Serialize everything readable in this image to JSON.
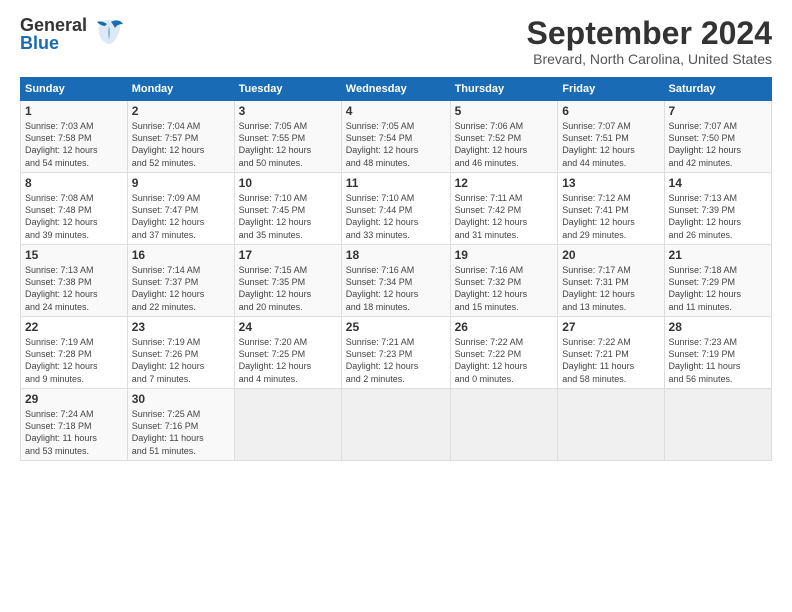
{
  "header": {
    "logo_line1": "General",
    "logo_line2": "Blue",
    "month_title": "September 2024",
    "location": "Brevard, North Carolina, United States"
  },
  "columns": [
    "Sunday",
    "Monday",
    "Tuesday",
    "Wednesday",
    "Thursday",
    "Friday",
    "Saturday"
  ],
  "weeks": [
    [
      {
        "day": "1",
        "lines": [
          "Sunrise: 7:03 AM",
          "Sunset: 7:58 PM",
          "Daylight: 12 hours",
          "and 54 minutes."
        ]
      },
      {
        "day": "2",
        "lines": [
          "Sunrise: 7:04 AM",
          "Sunset: 7:57 PM",
          "Daylight: 12 hours",
          "and 52 minutes."
        ]
      },
      {
        "day": "3",
        "lines": [
          "Sunrise: 7:05 AM",
          "Sunset: 7:55 PM",
          "Daylight: 12 hours",
          "and 50 minutes."
        ]
      },
      {
        "day": "4",
        "lines": [
          "Sunrise: 7:05 AM",
          "Sunset: 7:54 PM",
          "Daylight: 12 hours",
          "and 48 minutes."
        ]
      },
      {
        "day": "5",
        "lines": [
          "Sunrise: 7:06 AM",
          "Sunset: 7:52 PM",
          "Daylight: 12 hours",
          "and 46 minutes."
        ]
      },
      {
        "day": "6",
        "lines": [
          "Sunrise: 7:07 AM",
          "Sunset: 7:51 PM",
          "Daylight: 12 hours",
          "and 44 minutes."
        ]
      },
      {
        "day": "7",
        "lines": [
          "Sunrise: 7:07 AM",
          "Sunset: 7:50 PM",
          "Daylight: 12 hours",
          "and 42 minutes."
        ]
      }
    ],
    [
      {
        "day": "8",
        "lines": [
          "Sunrise: 7:08 AM",
          "Sunset: 7:48 PM",
          "Daylight: 12 hours",
          "and 39 minutes."
        ]
      },
      {
        "day": "9",
        "lines": [
          "Sunrise: 7:09 AM",
          "Sunset: 7:47 PM",
          "Daylight: 12 hours",
          "and 37 minutes."
        ]
      },
      {
        "day": "10",
        "lines": [
          "Sunrise: 7:10 AM",
          "Sunset: 7:45 PM",
          "Daylight: 12 hours",
          "and 35 minutes."
        ]
      },
      {
        "day": "11",
        "lines": [
          "Sunrise: 7:10 AM",
          "Sunset: 7:44 PM",
          "Daylight: 12 hours",
          "and 33 minutes."
        ]
      },
      {
        "day": "12",
        "lines": [
          "Sunrise: 7:11 AM",
          "Sunset: 7:42 PM",
          "Daylight: 12 hours",
          "and 31 minutes."
        ]
      },
      {
        "day": "13",
        "lines": [
          "Sunrise: 7:12 AM",
          "Sunset: 7:41 PM",
          "Daylight: 12 hours",
          "and 29 minutes."
        ]
      },
      {
        "day": "14",
        "lines": [
          "Sunrise: 7:13 AM",
          "Sunset: 7:39 PM",
          "Daylight: 12 hours",
          "and 26 minutes."
        ]
      }
    ],
    [
      {
        "day": "15",
        "lines": [
          "Sunrise: 7:13 AM",
          "Sunset: 7:38 PM",
          "Daylight: 12 hours",
          "and 24 minutes."
        ]
      },
      {
        "day": "16",
        "lines": [
          "Sunrise: 7:14 AM",
          "Sunset: 7:37 PM",
          "Daylight: 12 hours",
          "and 22 minutes."
        ]
      },
      {
        "day": "17",
        "lines": [
          "Sunrise: 7:15 AM",
          "Sunset: 7:35 PM",
          "Daylight: 12 hours",
          "and 20 minutes."
        ]
      },
      {
        "day": "18",
        "lines": [
          "Sunrise: 7:16 AM",
          "Sunset: 7:34 PM",
          "Daylight: 12 hours",
          "and 18 minutes."
        ]
      },
      {
        "day": "19",
        "lines": [
          "Sunrise: 7:16 AM",
          "Sunset: 7:32 PM",
          "Daylight: 12 hours",
          "and 15 minutes."
        ]
      },
      {
        "day": "20",
        "lines": [
          "Sunrise: 7:17 AM",
          "Sunset: 7:31 PM",
          "Daylight: 12 hours",
          "and 13 minutes."
        ]
      },
      {
        "day": "21",
        "lines": [
          "Sunrise: 7:18 AM",
          "Sunset: 7:29 PM",
          "Daylight: 12 hours",
          "and 11 minutes."
        ]
      }
    ],
    [
      {
        "day": "22",
        "lines": [
          "Sunrise: 7:19 AM",
          "Sunset: 7:28 PM",
          "Daylight: 12 hours",
          "and 9 minutes."
        ]
      },
      {
        "day": "23",
        "lines": [
          "Sunrise: 7:19 AM",
          "Sunset: 7:26 PM",
          "Daylight: 12 hours",
          "and 7 minutes."
        ]
      },
      {
        "day": "24",
        "lines": [
          "Sunrise: 7:20 AM",
          "Sunset: 7:25 PM",
          "Daylight: 12 hours",
          "and 4 minutes."
        ]
      },
      {
        "day": "25",
        "lines": [
          "Sunrise: 7:21 AM",
          "Sunset: 7:23 PM",
          "Daylight: 12 hours",
          "and 2 minutes."
        ]
      },
      {
        "day": "26",
        "lines": [
          "Sunrise: 7:22 AM",
          "Sunset: 7:22 PM",
          "Daylight: 12 hours",
          "and 0 minutes."
        ]
      },
      {
        "day": "27",
        "lines": [
          "Sunrise: 7:22 AM",
          "Sunset: 7:21 PM",
          "Daylight: 11 hours",
          "and 58 minutes."
        ]
      },
      {
        "day": "28",
        "lines": [
          "Sunrise: 7:23 AM",
          "Sunset: 7:19 PM",
          "Daylight: 11 hours",
          "and 56 minutes."
        ]
      }
    ],
    [
      {
        "day": "29",
        "lines": [
          "Sunrise: 7:24 AM",
          "Sunset: 7:18 PM",
          "Daylight: 11 hours",
          "and 53 minutes."
        ]
      },
      {
        "day": "30",
        "lines": [
          "Sunrise: 7:25 AM",
          "Sunset: 7:16 PM",
          "Daylight: 11 hours",
          "and 51 minutes."
        ]
      },
      null,
      null,
      null,
      null,
      null
    ]
  ]
}
